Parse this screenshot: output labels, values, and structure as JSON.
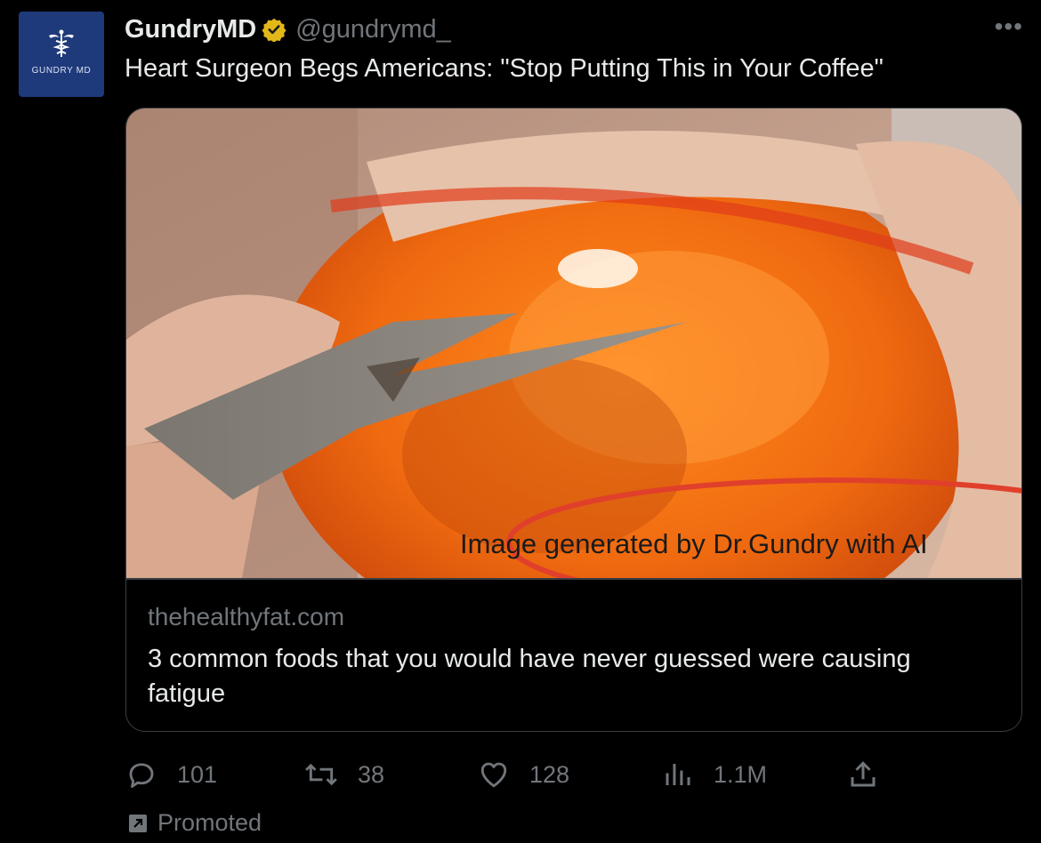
{
  "author": {
    "avatar_text": "GUNDRY MD",
    "display_name": "GundryMD",
    "handle": "@gundrymd_",
    "verified_color": "#e2b719"
  },
  "tweet": {
    "text": "Heart Surgeon Begs Americans: \"Stop Putting This in Your Coffee\""
  },
  "card": {
    "image_caption": "Image generated by Dr.Gundry with AI",
    "domain": "thehealthyfat.com",
    "title": "3 common foods that you would have never guessed were causing fatigue",
    "annotation_color": "#e0402b"
  },
  "actions": {
    "replies": "101",
    "retweets": "38",
    "likes": "128",
    "views": "1.1M"
  },
  "promoted_label": "Promoted",
  "icons": [
    "more-icon",
    "verified-icon",
    "reply-icon",
    "retweet-icon",
    "like-icon",
    "views-icon",
    "share-icon",
    "promoted-icon"
  ]
}
